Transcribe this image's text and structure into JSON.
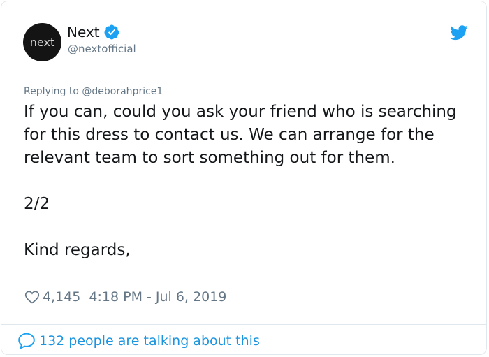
{
  "tweet": {
    "avatar_text": "next",
    "display_name": "Next",
    "handle": "@nextofficial",
    "replying_prefix": "Replying to ",
    "replying_mention": "@deborahprice1",
    "body_paragraph_1": "If you can, could you ask your friend who is searching for this dress to contact us. We can arrange for the relevant team to sort something out for them.",
    "body_paragraph_2": "2/2",
    "body_paragraph_3": "Kind regards,",
    "likes": "4,145",
    "timestamp": "4:18 PM - Jul 6, 2019",
    "talking": "132 people are talking about this"
  },
  "icons": {
    "verified": "verified-badge-icon",
    "bird": "twitter-bird-icon",
    "heart": "heart-icon",
    "bubble": "speech-bubble-icon"
  },
  "colors": {
    "accent": "#1da1f2",
    "link": "#1b95e0",
    "muted": "#657786",
    "text": "#14171a",
    "border": "#e1e8ed",
    "avatar_bg": "#141414"
  }
}
